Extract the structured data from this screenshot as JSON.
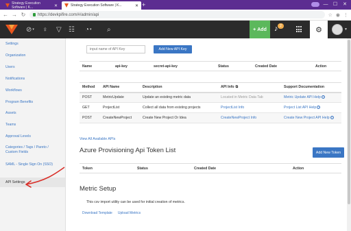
{
  "browser": {
    "tabs": [
      {
        "label": "Strategy Execution Software | K..."
      },
      {
        "label": "Strategy Execution Software | K..."
      }
    ],
    "url": "https://devkpifire.com/#/admin/api"
  },
  "appnav": {
    "add_label": "Add",
    "notification_count": "2"
  },
  "sidebar": {
    "items": [
      {
        "label": "Settings"
      },
      {
        "label": "Organization"
      },
      {
        "label": "Users"
      },
      {
        "label": "Notifications"
      },
      {
        "label": "Workflows"
      },
      {
        "label": "Program Benefits"
      },
      {
        "label": "Assets"
      },
      {
        "label": "Teams"
      },
      {
        "label": "Approval Levels"
      },
      {
        "label": "Categories / Tags / Pareto / Custom Fields"
      },
      {
        "label": "SAML - Single Sign On (SSO)"
      },
      {
        "label": "API Settings"
      }
    ]
  },
  "api_keys": {
    "input_placeholder": "input name of API Key",
    "add_button": "Add New API Key",
    "columns": [
      "Name",
      "api-key",
      "secret-api-key",
      "Status",
      "Created Date",
      "Action"
    ]
  },
  "api_methods": {
    "columns": [
      "Method",
      "API Name",
      "Description",
      "API Info",
      "Support Documentation"
    ],
    "rows": [
      {
        "method": "POST",
        "name": "MetricUpdate",
        "description": "Update an existing metric data",
        "info": "Located in Metric Data Tab",
        "doc": "Metric Update API Help"
      },
      {
        "method": "GET",
        "name": "ProjectList",
        "description": "Collect all data from existing projects",
        "info": "ProjectList Info",
        "doc": "Project List API Help"
      },
      {
        "method": "POST",
        "name": "CreateNewProject",
        "description": "Create New Project Or Idea",
        "info": "CreateNewProject Info",
        "doc": "Create New Project API Help"
      }
    ],
    "view_all": "View All Available APIs"
  },
  "azure": {
    "title": "Azure Provisioning Api Token List",
    "add_button": "Add New Token",
    "columns": [
      "Token",
      "Status",
      "Created Date",
      "Action"
    ]
  },
  "metric_setup": {
    "title": "Metric Setup",
    "description": "This csv import utility can be used for initial creation of metrics.",
    "download": "Download Template",
    "upload": "Upload Metrics"
  },
  "colors": {
    "accent": "#3a76c4",
    "success": "#5cb85c",
    "nav_bg": "#2b2b2b",
    "browser_frame": "#5c2d91",
    "annotation_arrow": "#d9302a"
  }
}
